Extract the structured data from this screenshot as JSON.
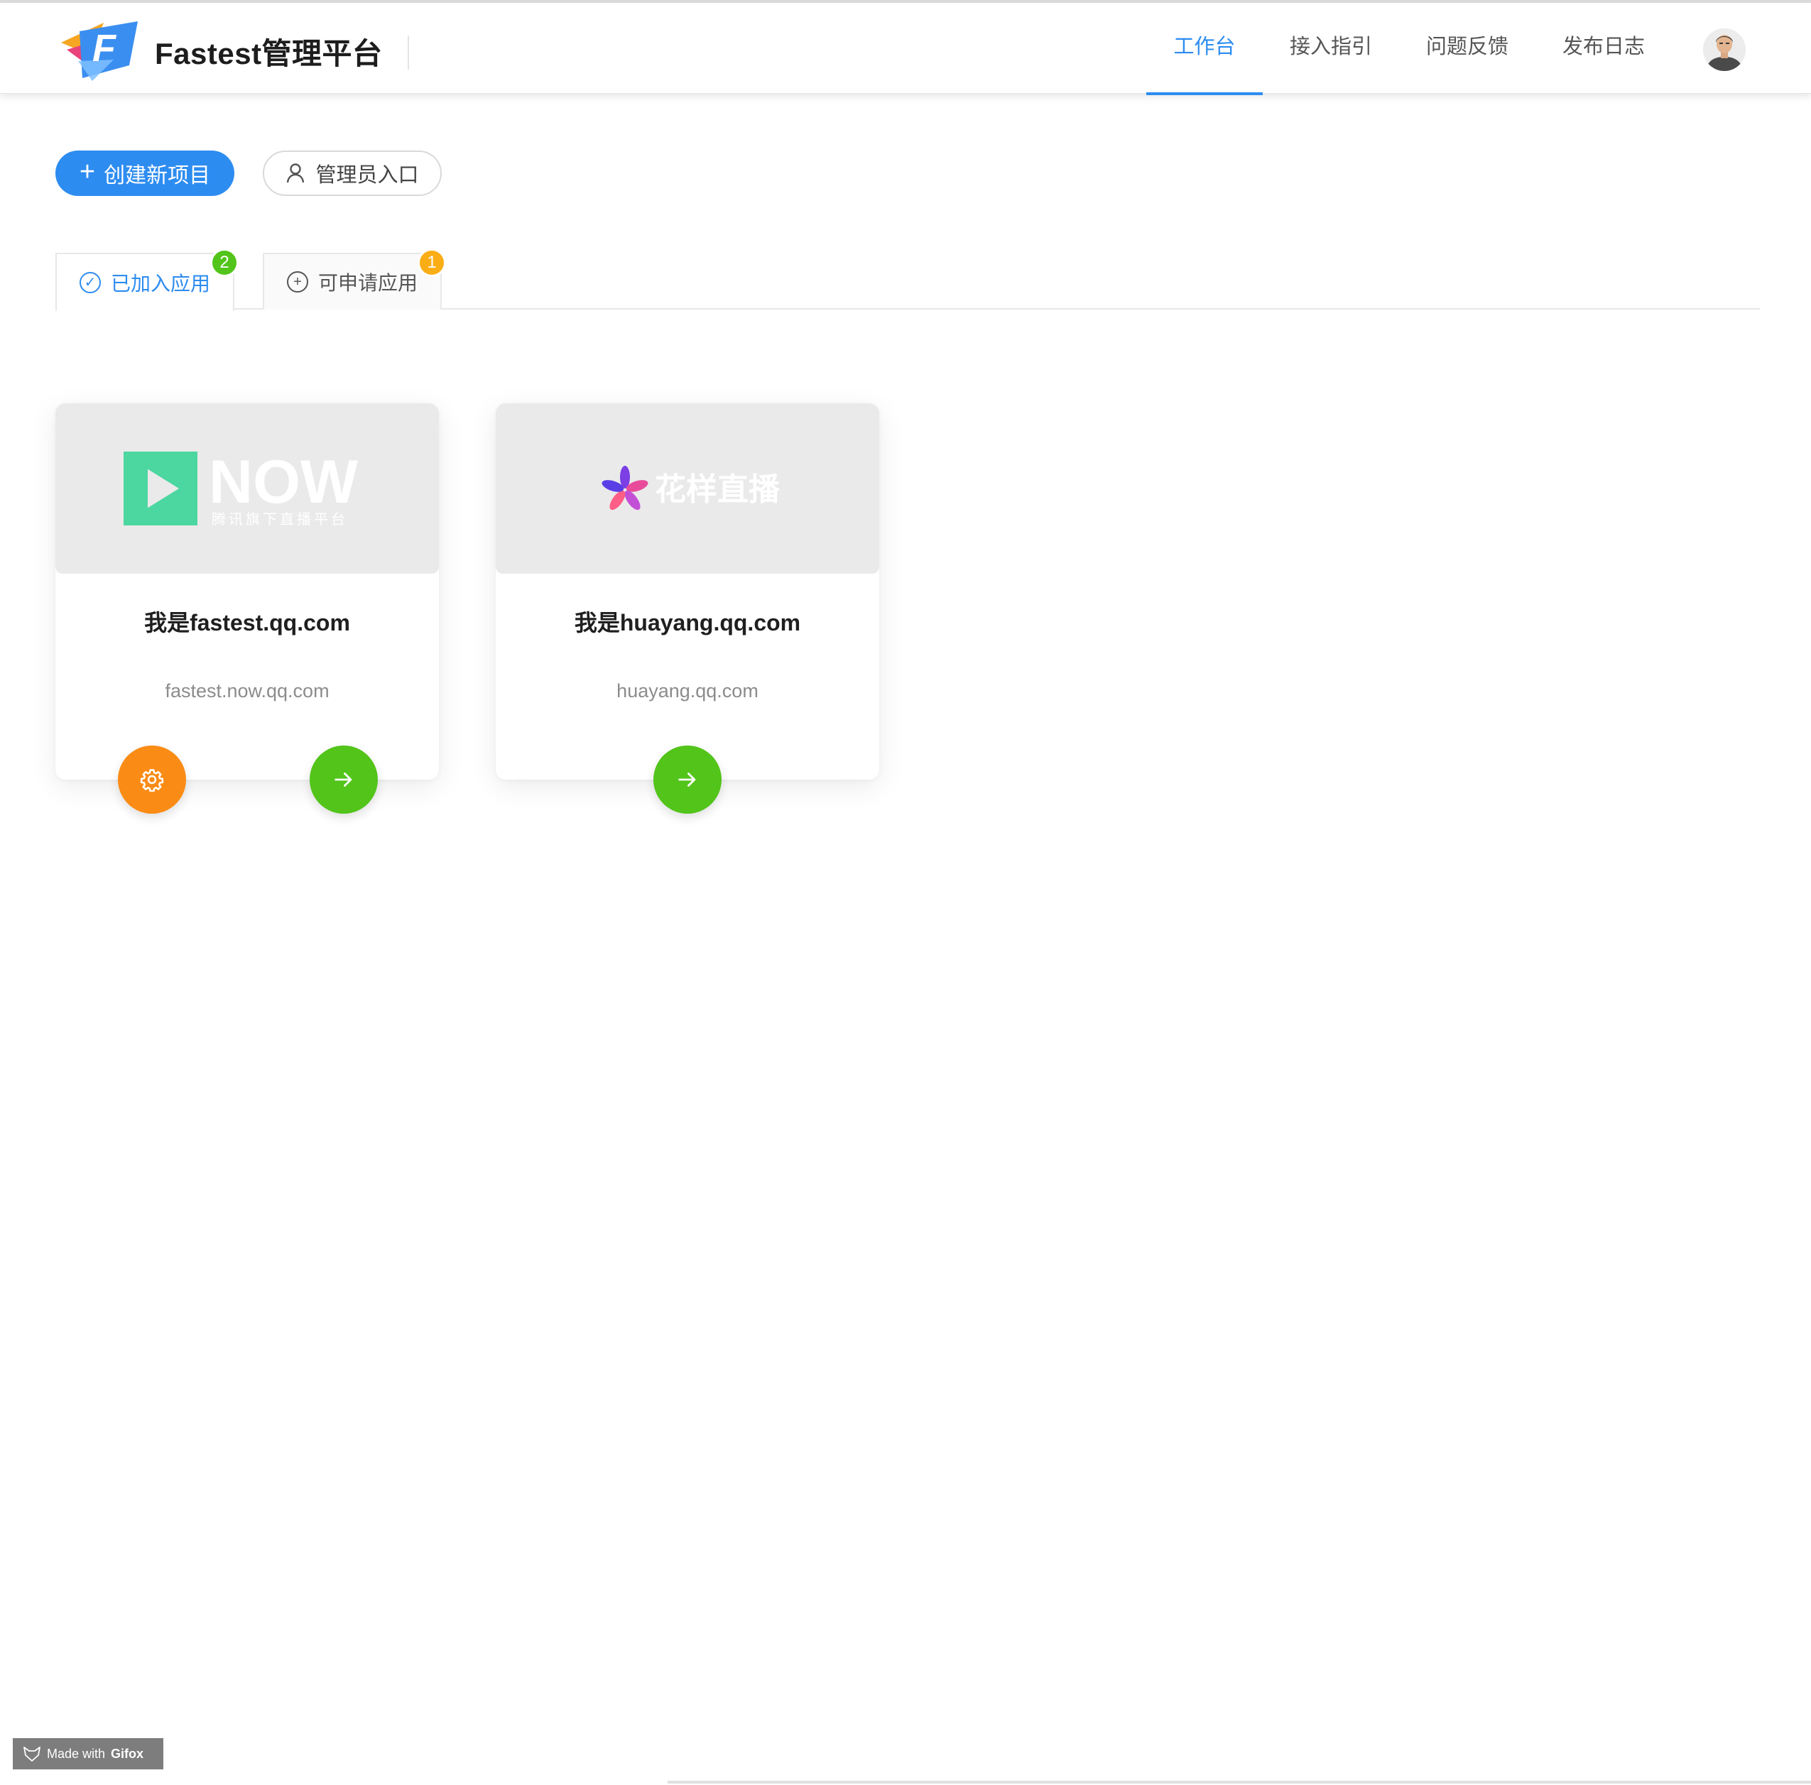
{
  "header": {
    "brand": "Fastest管理平台",
    "nav": [
      {
        "label": "工作台",
        "active": true
      },
      {
        "label": "接入指引",
        "active": false
      },
      {
        "label": "问题反馈",
        "active": false
      },
      {
        "label": "发布日志",
        "active": false
      }
    ],
    "avatar_icon": "user-avatar"
  },
  "actions": {
    "create_label": "创建新项目",
    "create_icon": "plus-icon",
    "admin_label": "管理员入口",
    "admin_icon": "user-icon"
  },
  "tabs": [
    {
      "label": "已加入应用",
      "icon": "check-circle-icon",
      "badge": "2",
      "badge_color": "#52c41a",
      "active": true
    },
    {
      "label": "可申请应用",
      "icon": "plus-circle-icon",
      "badge": "1",
      "badge_color": "#faad14",
      "active": false
    }
  ],
  "cards": [
    {
      "logo_text": "NOW",
      "logo_subtext": "腾讯旗下直播平台",
      "title": "我是fastest.qq.com",
      "domain": "fastest.now.qq.com",
      "buttons": [
        "settings",
        "enter"
      ]
    },
    {
      "logo_text": "花样直播",
      "title": "我是huayang.qq.com",
      "domain": "huayang.qq.com",
      "buttons": [
        "enter"
      ]
    }
  ],
  "colors": {
    "primary": "#2d8cf0",
    "green": "#52c41a",
    "orange": "#fa8c16",
    "badge_yellow": "#faad14"
  },
  "watermark": {
    "prefix": "Made with",
    "brand": "Gifox"
  }
}
